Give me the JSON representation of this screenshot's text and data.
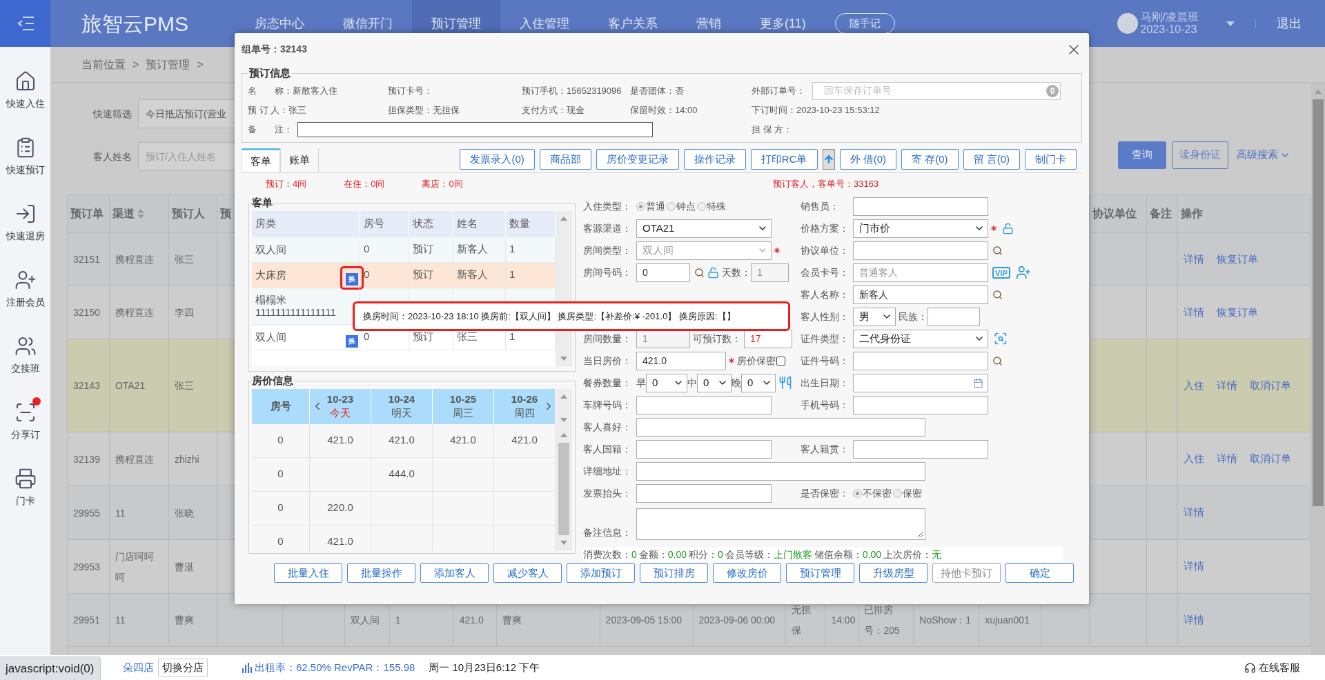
{
  "header": {
    "brand": "旅智云PMS",
    "nav": [
      {
        "label": "房态中心",
        "selected": false
      },
      {
        "label": "微信开门",
        "selected": false
      },
      {
        "label": "预订管理",
        "selected": true
      },
      {
        "label": "入住管理",
        "selected": false
      },
      {
        "label": "客户关系",
        "selected": false
      },
      {
        "label": "营销",
        "selected": false
      },
      {
        "label": "更多(11)",
        "selected": false
      }
    ],
    "note_button": "随手记",
    "user_name": "马刚/凌晨班",
    "user_date": "2023-10-23",
    "logout": "退出"
  },
  "sidebar": [
    {
      "label": "快速入住",
      "notified": false
    },
    {
      "label": "快速预订",
      "notified": false
    },
    {
      "label": "快速退房",
      "notified": false
    },
    {
      "label": "注册会员",
      "notified": false
    },
    {
      "label": "交接班",
      "notified": false
    },
    {
      "label": "分享订",
      "notified": true
    },
    {
      "label": "门卡",
      "notified": false
    }
  ],
  "breadcrumb": [
    "当前位置",
    ">",
    "预订管理",
    ">"
  ],
  "filters": {
    "quick_label": "快速筛选",
    "quick_value": "今日抵店预订(营业",
    "name_label": "客人姓名",
    "name_placeholder": "预订/入住人姓名",
    "search": "查询",
    "read_id": "读身份证",
    "advanced": "高级搜索"
  },
  "orders": {
    "columns": [
      {
        "label": "预订单",
        "sortable": false
      },
      {
        "label": "渠道",
        "sortable": true
      },
      {
        "label": "预订人",
        "sortable": false
      },
      {
        "label": "预"
      }
    ],
    "right_columns": [
      {
        "label": "协议单位"
      },
      {
        "label": "备注"
      },
      {
        "label": "操作"
      }
    ],
    "rows": [
      {
        "selected": false,
        "order": "32151",
        "channel": "携程直连",
        "booker": "张三",
        "actions": [
          "详情",
          "恢复订单"
        ]
      },
      {
        "selected": false,
        "order": "32150",
        "channel": "携程直连",
        "booker": "李四",
        "actions": [
          "详情",
          "恢复订单"
        ]
      },
      {
        "selected": true,
        "order": "32143",
        "channel": "OTA21",
        "booker": "张三",
        "actions": [
          "入住",
          "详情",
          "取消订单"
        ]
      },
      {
        "selected": false,
        "order": "32139",
        "channel": "携程直连",
        "booker": "zhizhi",
        "actions": [
          "入住",
          "详情",
          "取消订单"
        ]
      },
      {
        "selected": false,
        "order": "29955",
        "channel": "11",
        "booker": "张晓",
        "actions": [
          "详情"
        ]
      },
      {
        "selected": false,
        "order": "29953",
        "channel": "门店呵呵呵",
        "booker": "曹湛",
        "actions": [
          "详情"
        ]
      },
      {
        "selected": false,
        "order": "29951",
        "channel": "11",
        "booker": "曹爽",
        "cells": {
          "column_6": "双人间",
          "column_7": "1",
          "column_8": "421.0",
          "column_9": "曹爽",
          "column_10": "2023-09-05 15:00",
          "column_11": "2023-09-06 00:00",
          "column_12": "无担保",
          "column_13": "14:00",
          "column_14": "已排房号：205",
          "column_15": "NoShow：1",
          "column_16": "xujuan001"
        },
        "actions": [
          "详情"
        ]
      }
    ]
  },
  "dialog": {
    "title": "组单号：32143",
    "booking": {
      "legend": "预订信息",
      "rows": [
        [
          {
            "kind": "text",
            "label": "名　　称：",
            "value": "新散客入住"
          },
          {
            "kind": "text",
            "label": "预订卡号："
          },
          {
            "kind": "text",
            "label": "预订手机：",
            "value": "15652319096"
          },
          {
            "kind": "text",
            "label": "是否团体：",
            "value": "否"
          },
          {
            "kind": "input",
            "label": "外部订单号：",
            "placeholder": "回车保存订单号",
            "badge": "0"
          }
        ],
        [
          {
            "kind": "text",
            "label": "预 订 人：",
            "value": "张三"
          },
          {
            "kind": "text",
            "label": "担保类型：",
            "value": "无担保"
          },
          {
            "kind": "text",
            "label": "支付方式：",
            "value": "现金"
          },
          {
            "kind": "text",
            "label": "保留时效：",
            "value": "14:00"
          },
          {
            "kind": "text",
            "label": "下订时间：",
            "value": "2023-10-23 15:53:12"
          }
        ],
        [
          {
            "kind": "wide",
            "label": "备　　注："
          },
          "",
          "",
          "",
          {
            "kind": "text",
            "label": "担 保 方："
          }
        ]
      ]
    },
    "tabs": [
      {
        "label": "客单",
        "selected": true
      },
      {
        "label": "账单",
        "selected": false
      }
    ],
    "toolbar": [
      {
        "kind": "button",
        "label": "发票录入(0)"
      },
      {
        "kind": "button",
        "label": "商品部"
      },
      {
        "kind": "button",
        "label": "房价变更记录"
      },
      {
        "kind": "button",
        "label": "操作记录"
      },
      {
        "kind": "button",
        "label": "打印RC单"
      },
      {
        "kind": "upload"
      },
      {
        "kind": "button",
        "label": "外 借(0)"
      },
      {
        "kind": "button",
        "label": "寄 存(0)"
      },
      {
        "kind": "button",
        "label": "留 言(0)"
      },
      {
        "kind": "button",
        "label": "制门卡"
      }
    ],
    "summary": {
      "counts": [
        "预订：4间",
        "在住：0间",
        "离店：0间"
      ],
      "guest_order": "预订客人，客单号：33163"
    },
    "guests": {
      "legend": "客单",
      "columns": [
        "房类",
        "房号",
        "状态",
        "姓名",
        "数量"
      ],
      "rows": [
        {
          "selected": false,
          "room_type": "双人间",
          "room_no": "0",
          "status": "预订",
          "name": "新客人",
          "count": "1"
        },
        {
          "selected": true,
          "room_type": "大床房",
          "badge": "换",
          "room_no": "0",
          "status": "预订",
          "name": "新客人",
          "count": "1"
        },
        {
          "selected": false,
          "room_type": "榻榻米 1111111111111111"
        },
        {
          "selected": false,
          "room_type": "双人间",
          "badge": "换",
          "room_no": "0",
          "status": "预订",
          "name": "张三",
          "count": "1"
        }
      ]
    },
    "tooltip": "换房时间：2023-10-23 18:10 换房前:【双人间】 换房类型:【补差价:¥ -201.0】 换房原因:【】",
    "prices": {
      "legend": "房价信息",
      "room_label": "房号",
      "days": [
        {
          "date": "10-23",
          "day": "今天",
          "today": true
        },
        {
          "date": "10-24",
          "day": "明天",
          "today": false
        },
        {
          "date": "10-25",
          "day": "周三",
          "today": false
        },
        {
          "date": "10-26",
          "day": "周四",
          "today": false
        }
      ],
      "rows": [
        {
          "room": "0",
          "cells": [
            {
              "value": "421.0"
            },
            {
              "value": "421.0"
            },
            {
              "value": "421.0"
            },
            {
              "value": "421.0"
            }
          ]
        },
        {
          "room": "0",
          "cells": [
            {},
            {
              "value": "444.0"
            },
            {},
            {}
          ]
        },
        {
          "room": "0",
          "cells": [
            {
              "value": "220.0"
            },
            {},
            {},
            {}
          ]
        },
        {
          "room": "0",
          "cells": [
            {
              "value": "421.0"
            },
            {},
            {},
            {}
          ]
        }
      ]
    },
    "form": [
      {
        "left": {
          "kind": "radio",
          "label": "入住类型：",
          "options": [
            {
              "label": "普通",
              "selected": true
            },
            {
              "label": "钟点",
              "selected": false
            },
            {
              "label": "特殊",
              "selected": false
            }
          ]
        },
        "right": {
          "kind": "text",
          "label": "销售员："
        }
      },
      {
        "left": {
          "kind": "select",
          "label": "客源渠道：",
          "value": "OTA21",
          "disabled": false,
          "required": false
        },
        "right": {
          "kind": "plan",
          "label": "价格方案：",
          "value": "门市价"
        }
      },
      {
        "left": {
          "kind": "select",
          "label": "房间类型：",
          "value": "双人间",
          "disabled": true,
          "required": true
        },
        "right": {
          "kind": "lookup",
          "label": "协议单位："
        }
      },
      {
        "left": {
          "kind": "room",
          "label": "房间号码：",
          "value": "0",
          "days_label": "天数：",
          "days": "1"
        },
        "right": {
          "kind": "member",
          "label": "会员卡号：",
          "placeholder": "普通客人",
          "vip": "VIP"
        }
      },
      {
        "right": {
          "kind": "lookup",
          "label": "客人名称：",
          "value": "新客人"
        }
      },
      {
        "right": {
          "kind": "gender",
          "label": "客人性别：",
          "value": "男",
          "ethnicity_label": "民族："
        }
      },
      {
        "left": {
          "kind": "count",
          "label": "房间数量：",
          "value": "1",
          "available_label": "可预订数：",
          "available": "17"
        },
        "right": {
          "kind": "idtype",
          "label": "证件类型：",
          "value": "二代身份证"
        }
      },
      {
        "left": {
          "kind": "price",
          "label": "当日房价：",
          "value": "421.0",
          "secret_label": "房价保密",
          "secret": false
        },
        "right": {
          "kind": "lookup",
          "label": "证件号码："
        }
      },
      {
        "left": {
          "kind": "meal",
          "label": "餐券数量：",
          "meals": [
            {
              "label": "早",
              "value": "0"
            },
            {
              "label": "中",
              "value": "0"
            },
            {
              "label": "晚",
              "value": "0"
            }
          ]
        },
        "right": {
          "kind": "date",
          "label": "出生日期："
        }
      },
      {
        "left": {
          "kind": "text",
          "label": "车牌号码："
        },
        "right": {
          "kind": "text",
          "label": "手机号码："
        }
      },
      {
        "left": {
          "kind": "wide",
          "label": "客人喜好："
        }
      },
      {
        "left": {
          "kind": "text",
          "label": "客人国籍："
        },
        "right": {
          "kind": "text",
          "label": "客人籍贯："
        }
      },
      {
        "left": {
          "kind": "wide",
          "label": "详细地址："
        }
      },
      {
        "left": {
          "kind": "text",
          "label": "发票抬头："
        },
        "right": {
          "kind": "radio",
          "label": "是否保密：",
          "options": [
            {
              "label": "不保密",
              "selected": true
            },
            {
              "label": "保密",
              "selected": false
            }
          ]
        }
      },
      {
        "left": {
          "kind": "textarea",
          "label": "备注信息："
        }
      }
    ],
    "stats": [
      {
        "label": "消费次数：",
        "value": "0"
      },
      {
        "label": "金额：",
        "value": "0.00"
      },
      {
        "label": "积分：",
        "value": "0"
      },
      {
        "label": "会员等级：",
        "value": "上门散客"
      },
      {
        "label": "储值余额：",
        "value": "0.00"
      },
      {
        "label": "上次房价：",
        "value": "无"
      }
    ],
    "actions": [
      {
        "label": "批量入住",
        "disabled": false
      },
      {
        "label": "批量操作",
        "disabled": false
      },
      {
        "label": "添加客人",
        "disabled": false
      },
      {
        "label": "减少客人",
        "disabled": false
      },
      {
        "label": "添加预订",
        "disabled": false
      },
      {
        "label": "预订排房",
        "disabled": false
      },
      {
        "label": "修改房价",
        "disabled": false
      },
      {
        "label": "预订管理",
        "disabled": false
      },
      {
        "label": "升级房型",
        "disabled": false
      },
      {
        "label": "持他卡预订",
        "disabled": true
      },
      {
        "label": "确定",
        "disabled": false
      }
    ]
  },
  "status_bar": {
    "link_tooltip": "javascript:void(0)",
    "store": "朵四店",
    "switch_store": "切换分店",
    "occupancy": "出租率：62.50% RevPAR：155.98",
    "datetime": "周一 10月23日6:12 下午",
    "support": "在线客服"
  }
}
